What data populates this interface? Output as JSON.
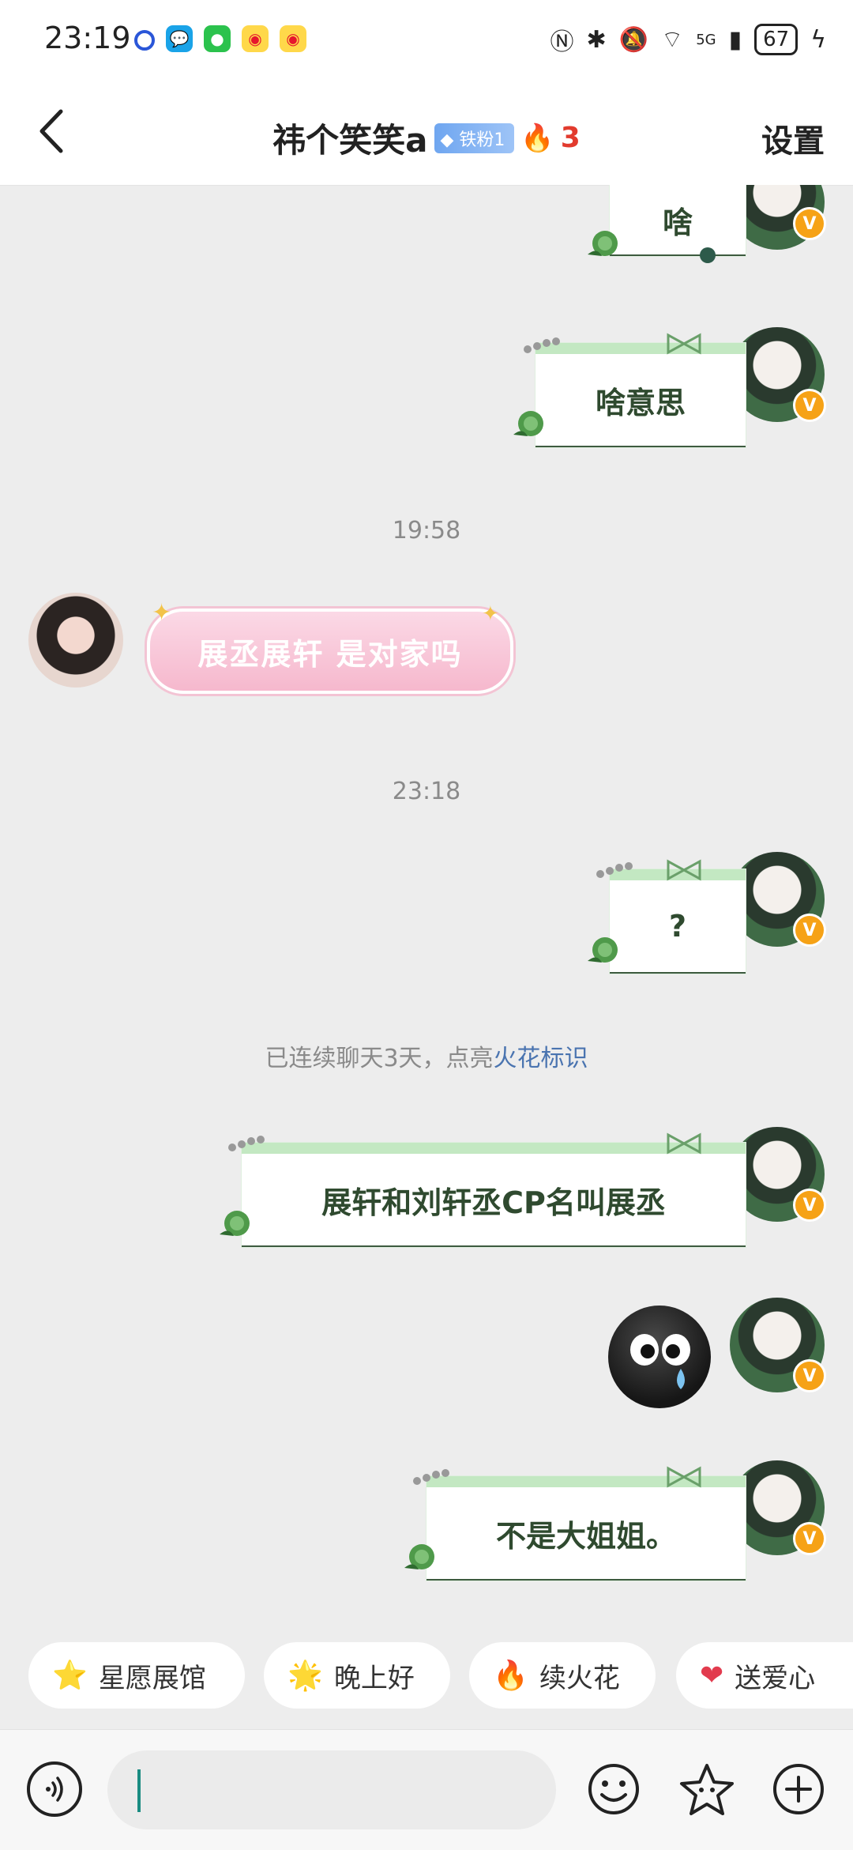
{
  "status_bar": {
    "time": "23:19",
    "network": "5G",
    "battery": "67"
  },
  "header": {
    "title": "祎个笑笑a",
    "fan_badge": "铁粉1",
    "spark_count": "3",
    "settings_label": "设置"
  },
  "messages": {
    "m1": "啥",
    "m2": "啥意思",
    "t1": "19:58",
    "m3": "展丞展轩 是对家吗",
    "t2": "23:18",
    "m4": "?",
    "system_prefix": "已连续聊天3天，点亮",
    "system_link": "火花标识",
    "m5": "展轩和刘轩丞CP名叫展丞",
    "m6": "不是大姐姐。"
  },
  "quick_replies": [
    "星愿展馆",
    "晚上好",
    "续火花",
    "送爱心"
  ],
  "colors": {
    "accent_link": "#4a74b0",
    "spark_red": "#e23b2e",
    "verified_orange": "#f6a216",
    "bubble_green_top": "#c3e8c2",
    "pink_bubble": "#f6b8cd"
  }
}
